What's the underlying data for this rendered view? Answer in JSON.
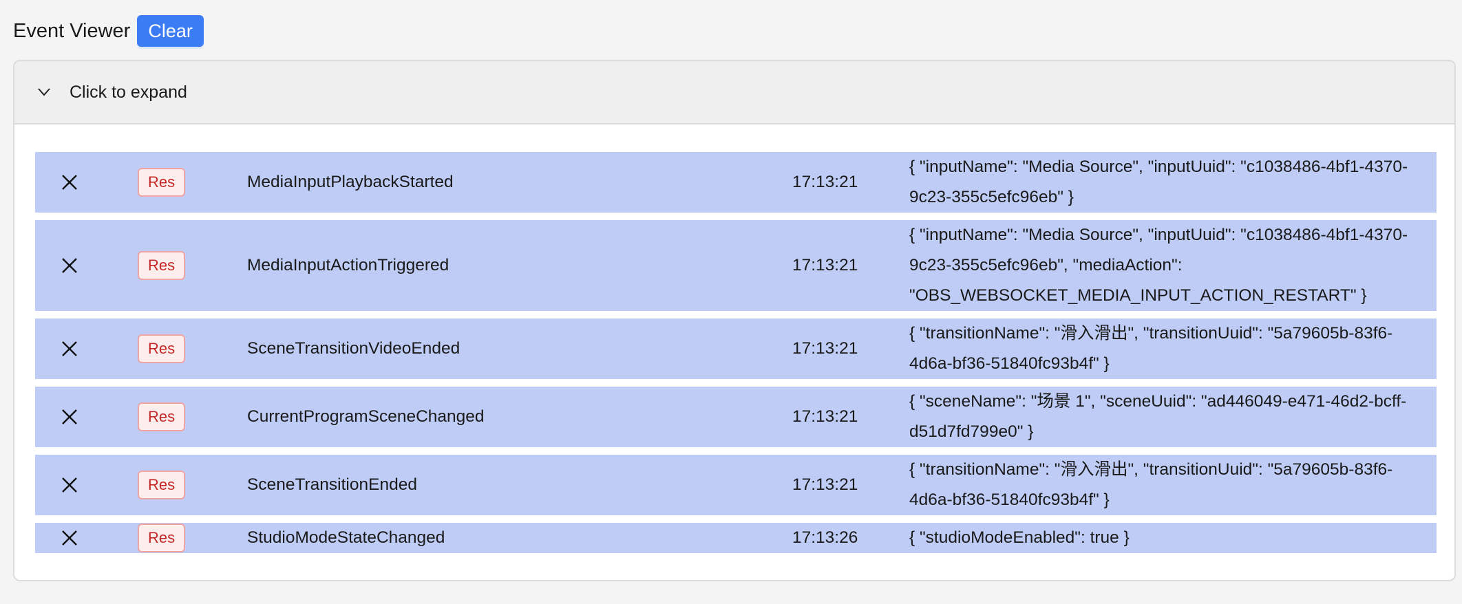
{
  "header": {
    "title": "Event Viewer",
    "clear_label": "Clear"
  },
  "panel": {
    "expand_label": "Click to expand",
    "chevron_icon": "chevron-down-icon"
  },
  "colors": {
    "row_bg": "#bfcdf6",
    "accent": "#3b7cf4",
    "badge_text": "#c62828"
  },
  "events": [
    {
      "badge": "Res",
      "name": "MediaInputPlaybackStarted",
      "time": "17:13:21",
      "data": "{ \"inputName\": \"Media Source\", \"inputUuid\": \"c1038486-4bf1-4370-9c23-355c5efc96eb\" }"
    },
    {
      "badge": "Res",
      "name": "MediaInputActionTriggered",
      "time": "17:13:21",
      "data": "{ \"inputName\": \"Media Source\", \"inputUuid\": \"c1038486-4bf1-4370-9c23-355c5efc96eb\", \"mediaAction\": \"OBS_WEBSOCKET_MEDIA_INPUT_ACTION_RESTART\" }"
    },
    {
      "badge": "Res",
      "name": "SceneTransitionVideoEnded",
      "time": "17:13:21",
      "data": "{ \"transitionName\": \"滑入滑出\", \"transitionUuid\": \"5a79605b-83f6-4d6a-bf36-51840fc93b4f\" }"
    },
    {
      "badge": "Res",
      "name": "CurrentProgramSceneChanged",
      "time": "17:13:21",
      "data": "{ \"sceneName\": \"场景 1\", \"sceneUuid\": \"ad446049-e471-46d2-bcff-d51d7fd799e0\" }"
    },
    {
      "badge": "Res",
      "name": "SceneTransitionEnded",
      "time": "17:13:21",
      "data": "{ \"transitionName\": \"滑入滑出\", \"transitionUuid\": \"5a79605b-83f6-4d6a-bf36-51840fc93b4f\" }"
    },
    {
      "badge": "Res",
      "name": "StudioModeStateChanged",
      "time": "17:13:26",
      "data": "{ \"studioModeEnabled\": true }"
    }
  ]
}
